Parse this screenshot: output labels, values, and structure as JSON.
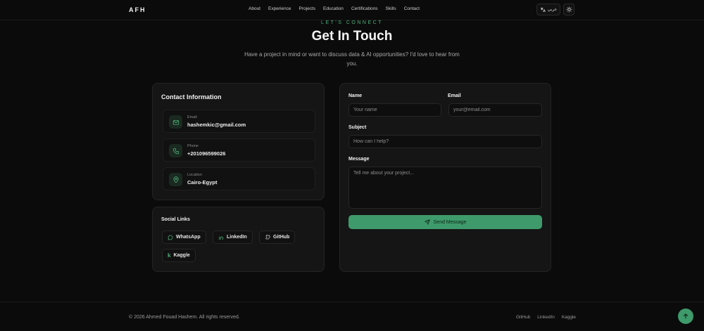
{
  "nav": {
    "logo": "AFH",
    "links": [
      "About",
      "Experience",
      "Projects",
      "Education",
      "Certifications",
      "Skills",
      "Contact"
    ],
    "lang_label": "عربي"
  },
  "header": {
    "eyebrow": "LET'S CONNECT",
    "title": "Get In Touch",
    "subtitle": "Have a project in mind or want to discuss data & AI opportunities? I'd love to hear from you."
  },
  "contact_info": {
    "title": "Contact Information",
    "items": [
      {
        "label": "Email",
        "value": "hashemkic@gmail.com",
        "icon": "mail-icon"
      },
      {
        "label": "Phone",
        "value": "+201096599026",
        "icon": "phone-icon"
      },
      {
        "label": "Location",
        "value": "Cairo-Egypt",
        "icon": "map-pin-icon"
      }
    ]
  },
  "social": {
    "title": "Social Links",
    "links": [
      {
        "label": "WhatsApp",
        "icon": "whatsapp-icon"
      },
      {
        "label": "LinkedIn",
        "icon": "linkedin-icon"
      },
      {
        "label": "GitHub",
        "icon": "github-icon"
      },
      {
        "label": "Kaggle",
        "icon": "kaggle-icon"
      }
    ]
  },
  "form": {
    "name_label": "Name",
    "name_placeholder": "Your name",
    "email_label": "Email",
    "email_placeholder": "your@email.com",
    "subject_label": "Subject",
    "subject_placeholder": "How can I help?",
    "message_label": "Message",
    "message_placeholder": "Tell me about your project...",
    "send_label": "Send Message"
  },
  "footer": {
    "copyright": "© 2026 Ahmed Fouad Hashem. All rights reserved.",
    "links": [
      "GitHub",
      "LinkedIn",
      "Kaggle"
    ]
  },
  "colors": {
    "accent": "#3e9a6a",
    "background": "#0b0b0b",
    "card": "#151515"
  }
}
